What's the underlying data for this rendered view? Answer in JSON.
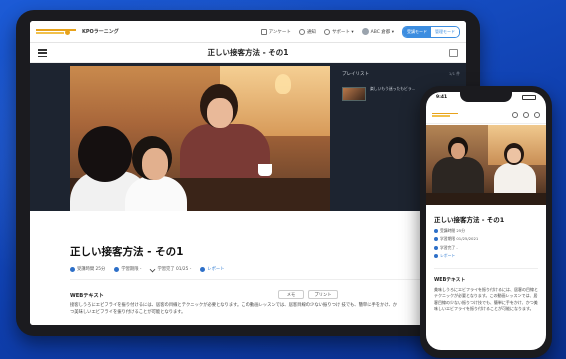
{
  "tablet": {
    "app_name": "KPOラーニング",
    "nav": {
      "survey": "アンケート",
      "notice": "通知",
      "support": "サポート ▾",
      "user": "ABC 倉都 ▾"
    },
    "mode": {
      "active": "受講モード",
      "inactive": "管理モード"
    },
    "page_title": "正しい接客方法 - その1",
    "playlist": {
      "title": "プレイリスト",
      "count": "1/1 件",
      "items": [
        {
          "label": "楽しいもう迷ったもビラ..."
        }
      ]
    },
    "lesson_title": "正しい接客方法 - その1",
    "meta": {
      "duration": "受講時間 25分",
      "deadline": "学習期限 -",
      "completed": "学習完了 01/25 -",
      "report": "レポート"
    },
    "section_title": "WEBテキスト",
    "buttons": {
      "memo": "メモ",
      "print": "プリント"
    },
    "body": "接客しうろにエビフライを振り付けるには、居客の目線とテクニックが必要となります。この動画レッスンでは、居客目線の少ない振りつけ 技でも、簡単に手をかけ、かつ美味しいエビフライを振り付けることが可能となります。"
  },
  "phone": {
    "time": "9:41",
    "lesson_title": "正しい接客方法 - その1",
    "meta": {
      "duration": "受講時間 25分",
      "deadline": "学習期限 01/25/2021",
      "completed": "学習完了 -",
      "report": "レポート"
    },
    "section_title": "WEBテキスト",
    "body": "美味しうろにエビフライを振り付けるには、居客の目線とテクニックが必要となります。この動画レッスンでは、居客目線の少ない振りつけ技でも、簡単に手をかけ、かつ美味しいエビフライを振り付けることが可能になります。"
  }
}
